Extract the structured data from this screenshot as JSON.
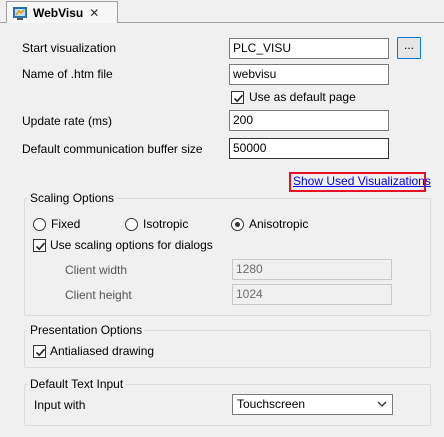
{
  "tab": {
    "title": "WebVisu",
    "close": "✕",
    "icon": "webvisu-icon"
  },
  "general": {
    "start_visualization": {
      "label": "Start visualization",
      "value": "PLC_VISU",
      "browse_label": "..."
    },
    "htm_file": {
      "label": "Name of .htm file",
      "value": "webvisu"
    },
    "default_page": {
      "label": "Use as default page",
      "checked": true
    },
    "update_rate": {
      "label": "Update rate (ms)",
      "value": "200"
    },
    "buffer_size": {
      "label": "Default communication buffer size",
      "value": "50000"
    }
  },
  "show_used_link": "Show Used Visualizations",
  "scaling": {
    "title": "Scaling Options",
    "options": [
      "Fixed",
      "Isotropic",
      "Anisotropic"
    ],
    "selected": "Anisotropic",
    "dialogs": {
      "label": "Use scaling options for dialogs",
      "checked": true
    },
    "client_width": {
      "label": "Client width",
      "value": "1280"
    },
    "client_height": {
      "label": "Client height",
      "value": "1024"
    }
  },
  "presentation": {
    "title": "Presentation Options",
    "antialiased": {
      "label": "Antialiased drawing",
      "checked": true
    }
  },
  "text_input": {
    "title": "Default Text Input",
    "input_with": {
      "label": "Input with",
      "value": "Touchscreen"
    }
  },
  "colors": {
    "link": "#0000ee",
    "highlight_border": "#e81123",
    "focus_border": "#0078d7"
  }
}
